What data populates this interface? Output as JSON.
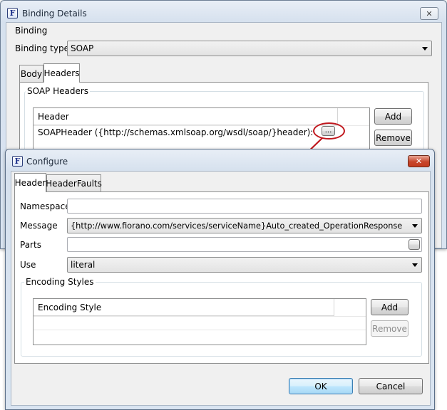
{
  "outer_window": {
    "title": "Binding Details",
    "app_icon": "F",
    "close_icon": "close-icon",
    "section_label": "Binding",
    "binding_type_label": "Binding type",
    "binding_type_value": "SOAP",
    "tabs": [
      "Body",
      "Headers"
    ],
    "active_tab": "Headers",
    "soap_headers_group": "SOAP Headers",
    "headers_table": {
      "column": "Header",
      "rows": [
        "SOAPHeader ({http://schemas.xmlsoap.org/wsdl/soap/}header):"
      ],
      "ellipsis_button": "..."
    },
    "add_button": "Add",
    "remove_button": "Remove"
  },
  "configure_dialog": {
    "title": "Configure",
    "app_icon": "F",
    "close_icon": "close-icon",
    "tabs": [
      "Header",
      "HeaderFaults"
    ],
    "active_tab": "Header",
    "namespace_label": "Namespace",
    "namespace_value": "",
    "message_label": "Message",
    "message_value": "{http://www.fiorano.com/services/serviceName}Auto_created_OperationResponse",
    "parts_label": "Parts",
    "parts_value": "",
    "use_label": "Use",
    "use_value": "literal",
    "encoding_group": "Encoding Styles",
    "encoding_table": {
      "column": "Encoding Style",
      "rows": []
    },
    "add_button": "Add",
    "remove_button": "Remove",
    "ok_button": "OK",
    "cancel_button": "Cancel"
  },
  "annotation": {
    "highlight_color": "#c0171d",
    "arrow_color": "#c0171d"
  }
}
